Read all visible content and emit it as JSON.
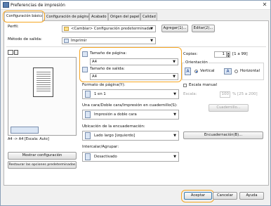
{
  "window": {
    "title": "Preferencias de impresión"
  },
  "tabs": [
    "Configuración básica",
    "Configuración de página",
    "Acabado",
    "Origen del papel",
    "Calidad"
  ],
  "profile": {
    "label": "Perfil:",
    "value": "<Cambiar> Configuración predeterminada",
    "add_label": "Agregar(1)...",
    "edit_label": "Editar(2)..."
  },
  "output": {
    "label": "Método de salida:",
    "value": "Imprimir"
  },
  "preview": {
    "caption": "A4 -> A4 [Escala: Auto]"
  },
  "paper": {
    "size_label": "Tamaño de página:",
    "size_value": "A4",
    "output_label": "Tamaño de salida:",
    "output_value": "A4"
  },
  "copies": {
    "label": "Copias:",
    "value": "1",
    "range": "[1 a 99]"
  },
  "orientation": {
    "label": "Orientación",
    "portrait": "Vertical",
    "landscape": "Horizontal",
    "selected": "Vertical"
  },
  "layout": {
    "label": "Formato de página(Y):",
    "value": "1 en 1"
  },
  "manual_scale": {
    "label": "Escala manual",
    "scale_label": "Escala:",
    "scale_value": "100",
    "scale_range": "% [25 a 200]"
  },
  "duplex": {
    "label": "Una cara/Doble cara/Impresión en cuadernillo(S):",
    "value": "Impresión a doble cara",
    "booklet_label": "Cuadernillo..."
  },
  "binding": {
    "label": "Ubicación de la encuadernación:",
    "value": "Lado largo [izquierdo]",
    "binding_button": "Encuadernación(B)..."
  },
  "collate": {
    "label": "Intercalar/Agrupar:",
    "value": "Desactivado"
  },
  "side_buttons": {
    "show_config": "Mostrar configuración",
    "restore_defaults": "Restaurar las opciones predeterminadas"
  },
  "footer": {
    "ok": "Aceptar",
    "cancel": "Cancelar",
    "help": "Ayuda"
  },
  "colors": {
    "highlight": "#f5a623",
    "accent": "#1a5fd0"
  }
}
